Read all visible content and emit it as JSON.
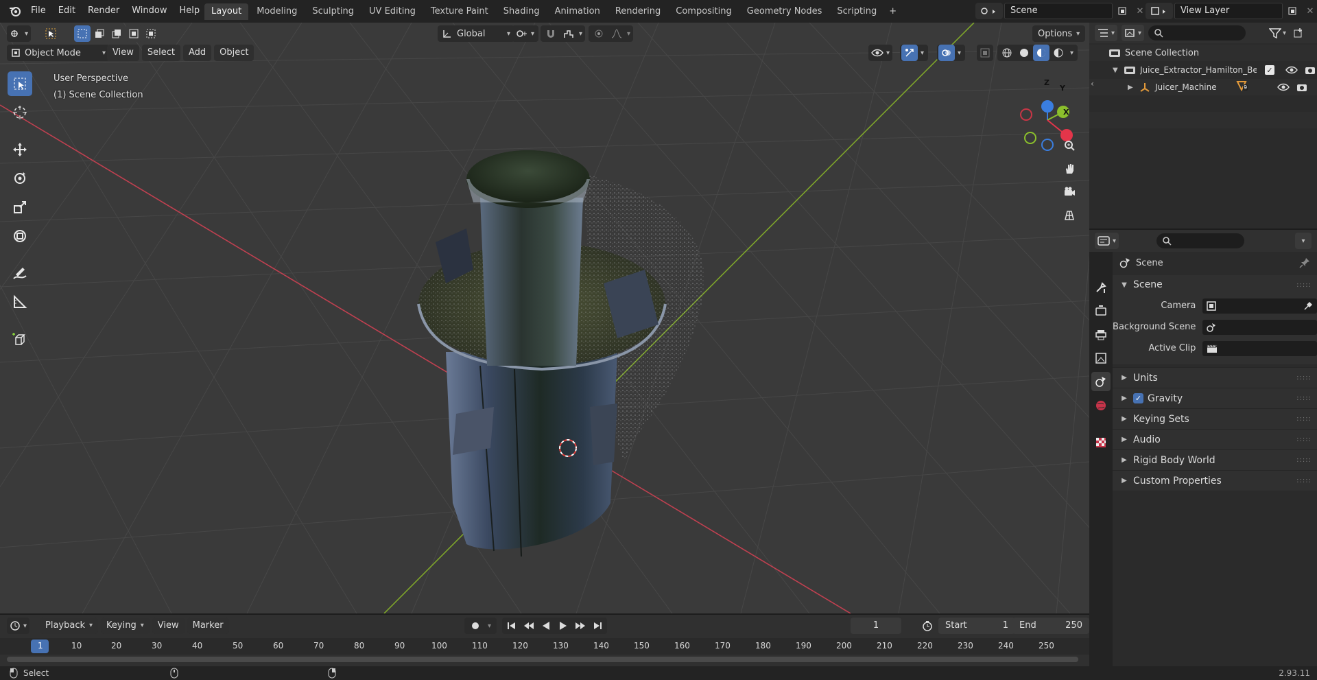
{
  "topbar": {
    "menus": [
      "File",
      "Edit",
      "Render",
      "Window",
      "Help"
    ],
    "workspaces": [
      "Layout",
      "Modeling",
      "Sculpting",
      "UV Editing",
      "Texture Paint",
      "Shading",
      "Animation",
      "Rendering",
      "Compositing",
      "Geometry Nodes",
      "Scripting"
    ],
    "active_workspace": "Layout",
    "add_tab": "+",
    "scene_name": "Scene",
    "view_layer": "View Layer"
  },
  "viewport_header": {
    "transform_orientation": "Global",
    "options_label": "Options",
    "mode": "Object Mode",
    "menus": [
      "View",
      "Select",
      "Add",
      "Object"
    ]
  },
  "viewport": {
    "perspective_label": "User Perspective",
    "collection_label": "(1) Scene Collection",
    "gizmo_axes": {
      "z": "Z",
      "y": "Y",
      "x": "X"
    }
  },
  "outliner": {
    "root": "Scene Collection",
    "items": [
      {
        "name": "Juice_Extractor_Hamilton_Bea"
      },
      {
        "name": "Juicer_Machine",
        "badge": "9"
      }
    ]
  },
  "properties": {
    "context": "Scene",
    "section": "Scene",
    "fields": [
      {
        "label": "Camera",
        "value": ""
      },
      {
        "label": "Background Scene",
        "value": ""
      },
      {
        "label": "Active Clip",
        "value": ""
      }
    ],
    "panels": [
      {
        "label": "Units",
        "checkbox": false
      },
      {
        "label": "Gravity",
        "checkbox": true
      },
      {
        "label": "Keying Sets",
        "checkbox": false
      },
      {
        "label": "Audio",
        "checkbox": false
      },
      {
        "label": "Rigid Body World",
        "checkbox": false
      },
      {
        "label": "Custom Properties",
        "checkbox": false
      }
    ]
  },
  "timeline": {
    "menus": [
      "Playback",
      "Keying",
      "View",
      "Marker"
    ],
    "current_frame": "1",
    "start_label": "Start",
    "start_value": "1",
    "end_label": "End",
    "end_value": "250",
    "ruler": [
      "1",
      "10",
      "20",
      "30",
      "40",
      "50",
      "60",
      "70",
      "80",
      "90",
      "100",
      "110",
      "120",
      "130",
      "140",
      "150",
      "160",
      "170",
      "180",
      "190",
      "200",
      "210",
      "220",
      "230",
      "240",
      "250"
    ]
  },
  "statusbar": {
    "left_label": "Select",
    "version": "2.93.11"
  },
  "colors": {
    "accent": "#4772b3",
    "x_axis": "#e3354a",
    "y_axis": "#8bbf2c",
    "z_axis": "#3a7ee0"
  }
}
